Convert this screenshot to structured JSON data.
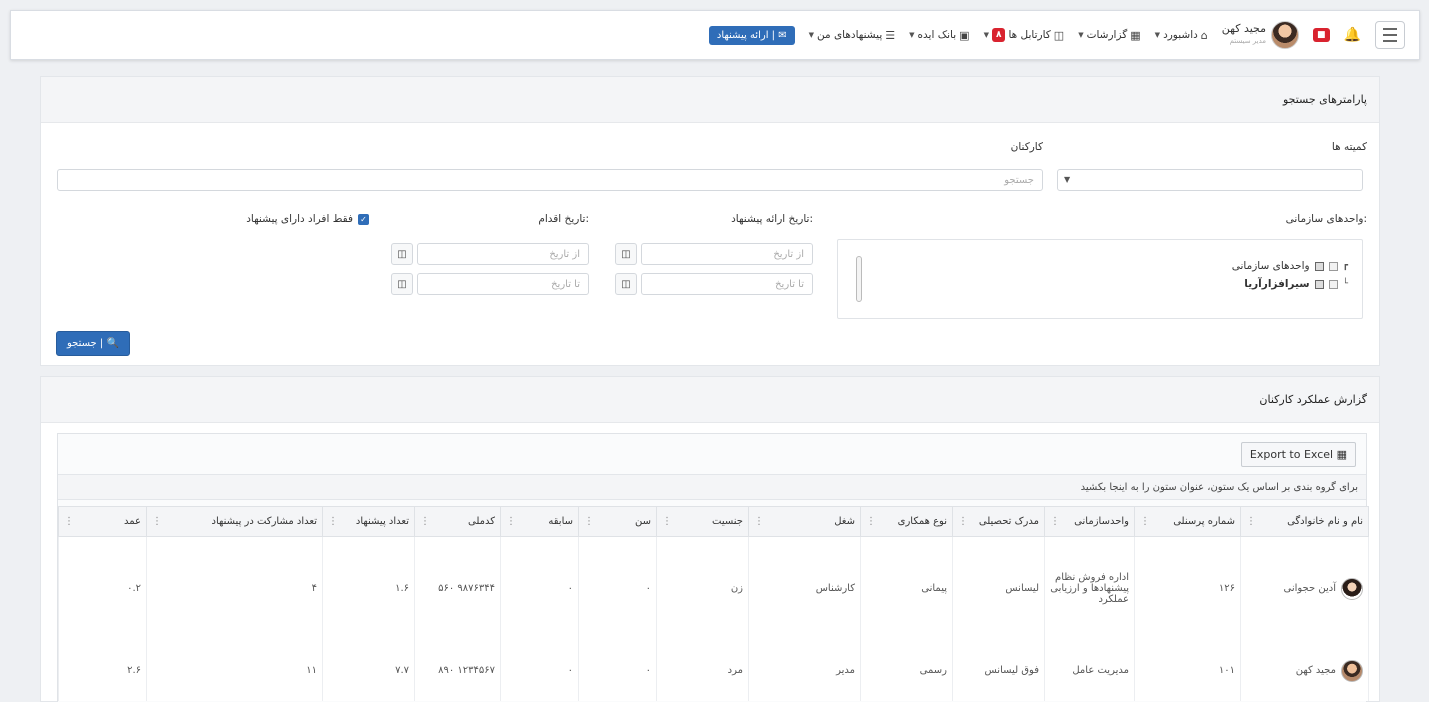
{
  "nav": {
    "badge_alerts": "■",
    "user_name": "مجید کهن",
    "user_sub": "مدیر سیستم",
    "items": [
      {
        "label": "داشبورد",
        "icon": "home-icon"
      },
      {
        "label": "گزارشات",
        "icon": "chart-icon"
      },
      {
        "label": "کارتابل ها",
        "icon": "desktop-icon",
        "badge": "۸"
      },
      {
        "label": "بانک ایده",
        "icon": "image-icon"
      },
      {
        "label": "پیشنهادهای من",
        "icon": "list-icon"
      }
    ],
    "submit_button": "ارائه پیشنهاد | ✉"
  },
  "search": {
    "title": "پارامترهای جستجو",
    "committees_label": "کمیته ها",
    "staff_label": "کارکنان",
    "staff_placeholder": "جستجو",
    "units_label": "واحدهای سازمانی:",
    "tree": [
      "واحدهای سازمانی",
      "سیرافزارآریا"
    ],
    "suggest_date_label": "تاریخ ارائه پیشنهاد:",
    "action_date_label": "تاریخ اقدام:",
    "from_date": "از تاریخ",
    "to_date": "تا تاریخ",
    "only_with_suggestions": "فقط افراد دارای پیشنهاد",
    "search_button": "جستجو | 🔍"
  },
  "report": {
    "title": "گزارش عملکرد کارکنان",
    "export_button": "Export to Excel",
    "group_hint": "برای گروه بندی بر اساس یک ستون، عنوان ستون را به اینجا بکشید",
    "columns": [
      "نام و نام خانوادگی",
      "شماره پرسنلی",
      "واحدسازمانی",
      "مدرک تحصیلی",
      "نوع همکاری",
      "شغل",
      "جنسیت",
      "سن",
      "سابقه",
      "کدملی",
      "تعداد پیشنهاد",
      "تعداد مشارکت در پیشنهاد",
      "عمد"
    ],
    "rows": [
      {
        "name": "آدین حجوانی",
        "personnel_no": "۱۲۶",
        "unit": "اداره فروش نظام پیشنهادها و ارزیابی عملکرد",
        "degree": "لیسانس",
        "contract": "پیمانی",
        "job": "کارشناس",
        "gender": "زن",
        "age": "۰",
        "experience": "۰",
        "national_id": "۹۸۷۶۳۴۴ ۵۶۰",
        "suggestions": "۱.۶",
        "participations": "۴",
        "other": "۰.۲"
      },
      {
        "name": "مجید کهن",
        "personnel_no": "۱۰۱",
        "unit": "مدیریت عامل",
        "degree": "فوق لیسانس",
        "contract": "رسمی",
        "job": "مدیر",
        "gender": "مرد",
        "age": "۰",
        "experience": "۰",
        "national_id": "۱۲۳۴۵۶۷ ۸۹۰",
        "suggestions": "۷.۷",
        "participations": "۱۱",
        "other": "۲.۶"
      }
    ]
  },
  "colors": {
    "primary": "#2f6db8",
    "danger": "#d9232f",
    "panel_header": "#f4f5f7"
  }
}
